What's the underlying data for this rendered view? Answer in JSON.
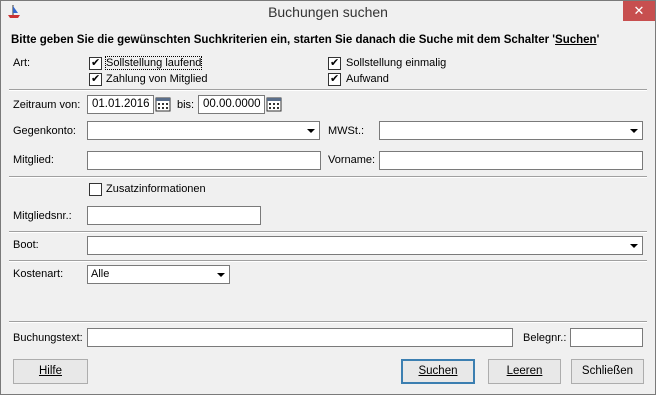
{
  "window": {
    "title": "Buchungen suchen",
    "close_glyph": "✕"
  },
  "instruction": {
    "prefix": "Bitte geben Sie die gewünschten Suchkriterien ein, starten Sie danach die Suche mit dem Schalter '",
    "link": "Suchen",
    "suffix": "'"
  },
  "art": {
    "label": "Art:",
    "options": [
      {
        "label": "Sollstellung laufend",
        "checked": true
      },
      {
        "label": "Zahlung von Mitglied",
        "checked": true
      },
      {
        "label": "Sollstellung einmalig",
        "checked": true
      },
      {
        "label": "Aufwand",
        "checked": true
      }
    ]
  },
  "zeitraum": {
    "label": "Zeitraum von:",
    "from": "01.01.2016",
    "to_label": "bis:",
    "to": "00.00.0000"
  },
  "gegenkonto": {
    "label": "Gegenkonto:",
    "value": ""
  },
  "mwst": {
    "label": "MWSt.:",
    "value": ""
  },
  "mitglied": {
    "label": "Mitglied:",
    "value": ""
  },
  "vorname": {
    "label": "Vorname:",
    "value": ""
  },
  "zusatz": {
    "label": "Zusatzinformationen",
    "checked": false
  },
  "mitgliedsnr": {
    "label": "Mitgliedsnr.:",
    "value": ""
  },
  "boot": {
    "label": "Boot:",
    "value": ""
  },
  "kostenart": {
    "label": "Kostenart:",
    "value": "Alle"
  },
  "buchungstext": {
    "label": "Buchungstext:",
    "value": ""
  },
  "belegnr": {
    "label": "Belegnr.:",
    "value": ""
  },
  "buttons": {
    "hilfe": "Hilfe",
    "suchen": "Suchen",
    "leeren": "Leeren",
    "schliessen": "Schließen"
  },
  "colors": {
    "close_button": "#c74f4f",
    "default_button_border": "#3c7fb1"
  }
}
